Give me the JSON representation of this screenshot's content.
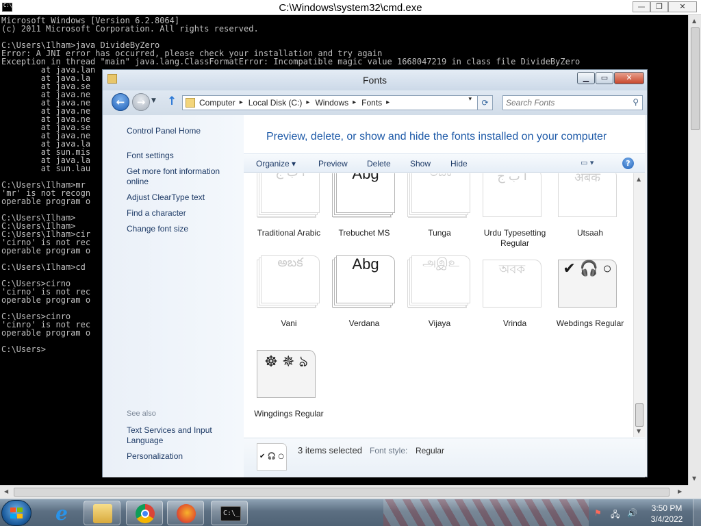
{
  "cmd": {
    "title": "C:\\Windows\\system32\\cmd.exe",
    "controls": {
      "minimize": "—",
      "maximize": "❐",
      "close": "✕"
    },
    "lines": [
      "Microsoft Windows [Version 6.2.8064]",
      "(c) 2011 Microsoft Corporation. All rights reserved.",
      "",
      "C:\\Users\\Ilham>java DivideByZero",
      "Error: A JNI error has occurred, please check your installation and try again",
      "Exception in thread \"main\" java.lang.ClassFormatError: Incompatible magic value 1668047219 in class file DivideByZero",
      "        at java.lan",
      "        at java.la",
      "        at java.se",
      "        at java.ne",
      "        at java.ne",
      "        at java.ne",
      "        at java.ne",
      "        at java.se",
      "        at java.ne",
      "        at java.la",
      "        at sun.mis",
      "        at java.la",
      "        at sun.lau",
      "",
      "C:\\Users\\Ilham>mr",
      "'mr' is not recogn",
      "operable program o",
      "",
      "C:\\Users\\Ilham>",
      "C:\\Users\\Ilham>",
      "C:\\Users\\Ilham>cir",
      "'cirno' is not rec",
      "operable program o",
      "",
      "C:\\Users\\Ilham>cd",
      "",
      "C:\\Users>cirno",
      "'cirno' is not rec",
      "operable program o",
      "",
      "C:\\Users>cinro",
      "'cinro' is not rec",
      "operable program o",
      "",
      "C:\\Users>"
    ]
  },
  "fonts_window": {
    "title": "Fonts",
    "controls": {
      "minimize": "▁",
      "maximize": "▭",
      "close": "✕"
    },
    "nav": {
      "back_icon": "back-arrow-icon",
      "back": "←",
      "forward": "→",
      "recent": "▼",
      "up": "↑"
    },
    "breadcrumbs": [
      "Computer",
      "Local Disk (C:)",
      "Windows",
      "Fonts"
    ],
    "breadcrumb_separator": "▸",
    "address_dropdown": "▾",
    "refresh": "⟳",
    "search_placeholder": "Search Fonts",
    "search_icon": "⚲",
    "sidebar": {
      "home": "Control Panel Home",
      "links": [
        "Font settings",
        "Get more font information online",
        "Adjust ClearType text",
        "Find a character",
        "Change font size"
      ],
      "see_also_heading": "See also",
      "see_also_links": [
        "Text Services and Input Language",
        "Personalization"
      ]
    },
    "heading": "Preview, delete, or show and hide the fonts installed on your computer",
    "commands": {
      "organize": "Organize ▾",
      "preview": "Preview",
      "delete": "Delete",
      "show": "Show",
      "hide": "Hide",
      "views": "▭  ▾",
      "help": "?"
    },
    "fonts": [
      {
        "name": "Traditional Arabic",
        "sample": "أ ب ج",
        "faded": true,
        "stack": true
      },
      {
        "name": "Trebuchet MS",
        "sample": "Abg",
        "faded": false,
        "stack": true
      },
      {
        "name": "Tunga",
        "sample": "ಅಬಕ",
        "faded": true,
        "stack": true
      },
      {
        "name": "Urdu Typesetting Regular",
        "sample": "أ ب ج",
        "faded": true,
        "stack": false
      },
      {
        "name": "Utsaah",
        "sample": "अबक",
        "faded": true,
        "stack": false
      },
      {
        "name": "Vani",
        "sample": "అబక",
        "faded": true,
        "stack": true
      },
      {
        "name": "Verdana",
        "sample": "Abg",
        "faded": false,
        "stack": true
      },
      {
        "name": "Vijaya",
        "sample": "அஇஉ",
        "faded": true,
        "stack": true
      },
      {
        "name": "Vrinda",
        "sample": "অবক",
        "faded": true,
        "stack": false
      },
      {
        "name": "Webdings Regular",
        "sample": "✔ 🎧 ○",
        "faded": false,
        "stack": false,
        "selected": true
      },
      {
        "name": "Wingdings Regular",
        "sample": "☸ ✵ ঌ",
        "faded": false,
        "stack": false,
        "selected": true
      }
    ],
    "details": {
      "thumbnail": "✔ 🎧 ○",
      "count": "3 items selected",
      "style_label": "Font style:",
      "style_value": "Regular"
    }
  },
  "taskbar": {
    "apps": [
      "Internet Explorer",
      "Windows Explorer",
      "Google Chrome",
      "Firefox",
      "Command Prompt"
    ],
    "ie_glyph": "e",
    "cmd_glyph": "C:\\_",
    "tray": {
      "flag": "⚑",
      "network": "🖧",
      "volume": "🔊"
    },
    "time": "3:50 PM",
    "date": "3/4/2022"
  },
  "colors": {
    "cmd_text": "#c0c0c0",
    "heading_blue": "#1e5aa8",
    "link_navy": "#1d3a66"
  }
}
